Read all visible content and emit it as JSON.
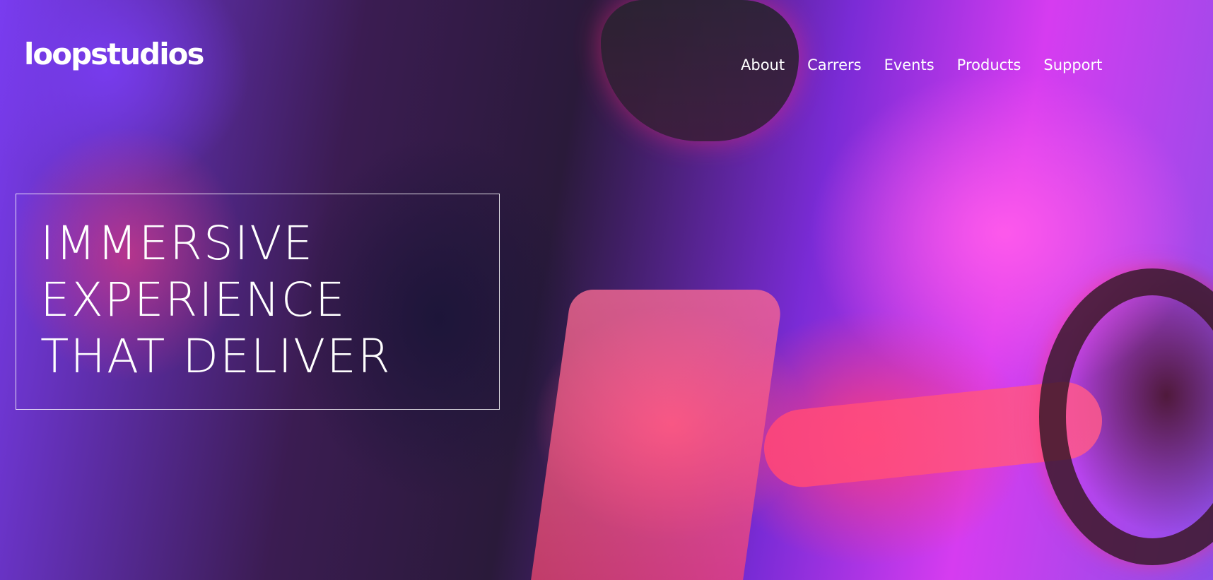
{
  "brand": {
    "logo_text": "loopstudios"
  },
  "nav": {
    "items": [
      {
        "label": "About"
      },
      {
        "label": "Carrers"
      },
      {
        "label": "Events"
      },
      {
        "label": "Products"
      },
      {
        "label": "Support"
      }
    ]
  },
  "hero": {
    "headline_lines": [
      "IMMERSIVE",
      "EXPERIENCE",
      "THAT DELIVER"
    ]
  },
  "colors": {
    "text": "#ffffff",
    "accent_pink": "#ff40c8",
    "accent_violet": "#7a3cf0"
  }
}
